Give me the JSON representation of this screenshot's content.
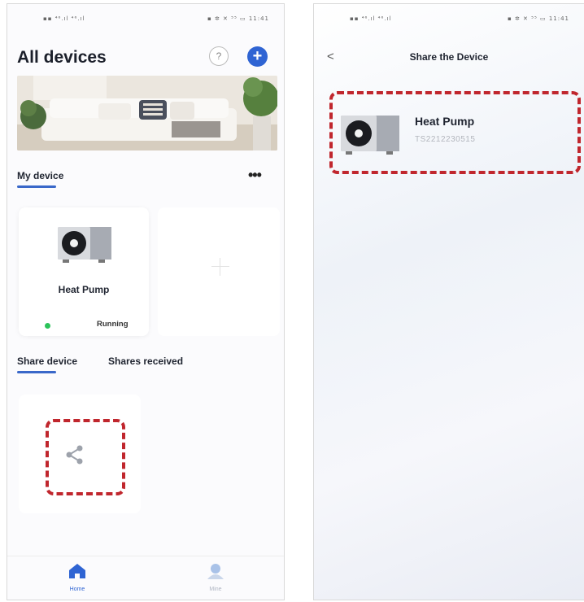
{
  "status_bar": {
    "left": "▪▪ ⁴⁶.ıl ⁴⁶.ıl",
    "right": "▪ ✲ ✕ ⁵⁵ ▭ 11:41"
  },
  "home": {
    "title": "All devices",
    "help_label": "?",
    "add_label": "+",
    "my_device_tab": "My device",
    "more_label": "•••",
    "device": {
      "name": "Heat Pump",
      "status": "Running",
      "status_color": "#2cc35a"
    },
    "share_tabs": {
      "share_device": "Share device",
      "shares_received": "Shares received"
    },
    "nav": {
      "home": "Home",
      "mine": "Mine"
    }
  },
  "share_page": {
    "title": "Share the Device",
    "back_label": "<",
    "device": {
      "name": "Heat Pump",
      "serial": "TS2212230515"
    }
  },
  "colors": {
    "accent": "#2f64d3",
    "highlight_dash": "#c0262d"
  }
}
